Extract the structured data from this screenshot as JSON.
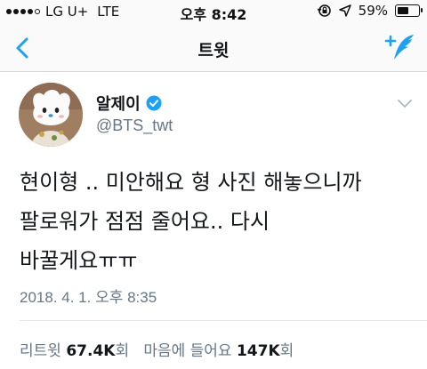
{
  "status_bar": {
    "carrier": "LG U+",
    "network": "LTE",
    "time": "오후 8:42",
    "battery_text": "59%",
    "battery_level": 0.59,
    "signal_bars": 4,
    "icons": [
      "lock-rotation-icon",
      "location-arrow-icon",
      "battery-icon"
    ]
  },
  "nav": {
    "back_icon": "chevron-left-icon",
    "title": "트윗",
    "compose_icon": "compose-tweet-icon",
    "accent_color": "#1da1f2"
  },
  "tweet": {
    "display_name": "알제이",
    "verified": true,
    "handle": "@BTS_twt",
    "lines": [
      "현이형 .. 미안해요 형 사진 해놓으니까",
      "팔로워가 점점 줄어요.. 다시",
      "바꿀게요ㅠㅠ"
    ],
    "timestamp": "2018. 4. 1. 오후 8:35",
    "stats": {
      "retweet_label": "리트윗",
      "retweet_count": "67.4K",
      "retweet_unit": "회",
      "like_label": "마음에 들어요",
      "like_count": "147K",
      "like_unit": "회"
    }
  }
}
